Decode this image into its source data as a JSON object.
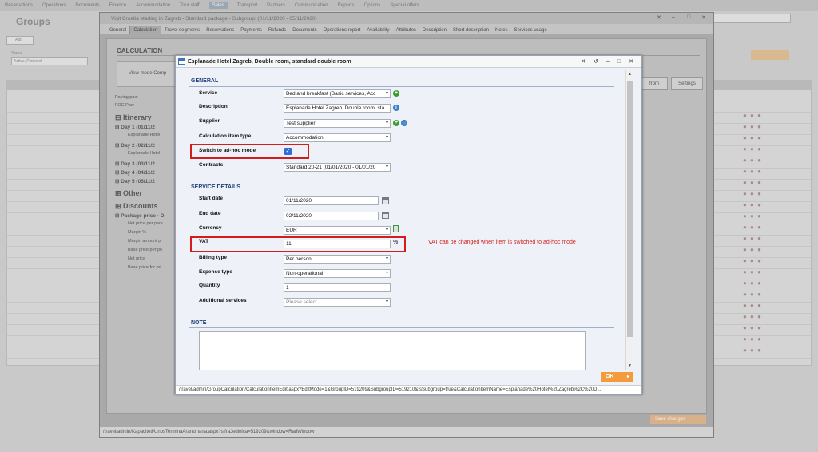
{
  "background": {
    "topnav": [
      "Reservations",
      "Operations",
      "Documents",
      "Finance",
      "Accommodation",
      "Tour staff",
      "Sales",
      "Transport",
      "Partners",
      "Communication",
      "Reports",
      "Options",
      "Special offers"
    ],
    "topnav_active_index": 6,
    "page_title": "Groups",
    "add_button": "Add",
    "status_label": "Status",
    "status_value": "Active, Planned"
  },
  "outer": {
    "title": "Visit Croatia starting in Zagreb - Standard package - Subgroup: (01/11/2020 - 05/11/2020)",
    "tabs": [
      "General",
      "Calculation",
      "Travel segments",
      "Reservations",
      "Payments",
      "Refunds",
      "Documents",
      "Operations report",
      "Availability",
      "Attributes",
      "Description",
      "Short description",
      "Notes",
      "Services usage"
    ],
    "active_tab": "Calculation",
    "calc_heading": "CALCULATION",
    "view_mode": "View mode",
    "view_mode_value": "Comp",
    "from_button": "from",
    "settings_button": "Settings",
    "paying_pax": "Paying pax:",
    "foc_pax": "FOC Pax:",
    "itinerary": "Itinerary",
    "days": [
      {
        "label": "Day 1 (01/11/2",
        "sub": "Esplanade Hotel"
      },
      {
        "label": "Day 2 (02/11/2",
        "sub": "Esplanade Hotel"
      },
      {
        "label": "Day 3 (03/11/2",
        "sub": ""
      },
      {
        "label": "Day 4 (04/11/2",
        "sub": ""
      },
      {
        "label": "Day 5 (05/11/2",
        "sub": ""
      }
    ],
    "other": "Other",
    "discounts": "Discounts",
    "package_price": "Package price - D",
    "price_rows": [
      "Net price per pers",
      "Margin %",
      "Margin amount p",
      "Base price per pe",
      "Net price",
      "Base price for pri"
    ],
    "save_changes": "Save changes",
    "status_url": "/travel/admin/Kapaciteti/UnosTerminaAranzmana.aspx?sifraJedinica=519209&window=RadWindow"
  },
  "dialog": {
    "title": "Esplanade Hotel Zagreb, Double room, standard double room",
    "general_heading": "GENERAL",
    "service_label": "Service",
    "service_value": "Bed and breakfast (Basic services, Acc",
    "description_label": "Description",
    "description_value": "Esplanade Hotel Zagreb, Double room, sta",
    "supplier_label": "Supplier",
    "supplier_value": "Test supplier",
    "calc_item_type_label": "Calculation item type",
    "calc_item_type_value": "Accommodation",
    "adhoc_label": "Switch to ad-hoc mode",
    "adhoc_checked": true,
    "contracts_label": "Contracts",
    "contracts_value": "Standard 20-21 (01/01/2020 - 01/01/20",
    "service_details_heading": "SERVICE DETAILS",
    "start_date_label": "Start date",
    "start_date_value": "01/11/2020",
    "end_date_label": "End date",
    "end_date_value": "02/11/2020",
    "currency_label": "Currency",
    "currency_value": "EUR",
    "vat_label": "VAT",
    "vat_value": "11",
    "vat_unit": "%",
    "vat_note": "VAT can be changed when item is switched to ad-hoc mode",
    "billing_type_label": "Billing type",
    "billing_type_value": "Per person",
    "expense_type_label": "Expense type",
    "expense_type_value": "Non-operational",
    "quantity_label": "Quantity",
    "quantity_value": "1",
    "additional_services_label": "Additional services",
    "additional_services_placeholder": "Please select",
    "note_heading": "NOTE",
    "ok_button": "OK",
    "status_url": "/travel/admin/GroupCalculation/CalculationItemEdit.aspx?EditMode=1&GroupID=519209&SubgroupID=519210&IsSubgroup=true&CalculationItemName=Esplanade%20Hotel%20Zagreb%2C%20D..."
  },
  "colors": {
    "highlight": "#d31d1d",
    "ok": "#f39c3c",
    "heading": "#1f3f78"
  }
}
